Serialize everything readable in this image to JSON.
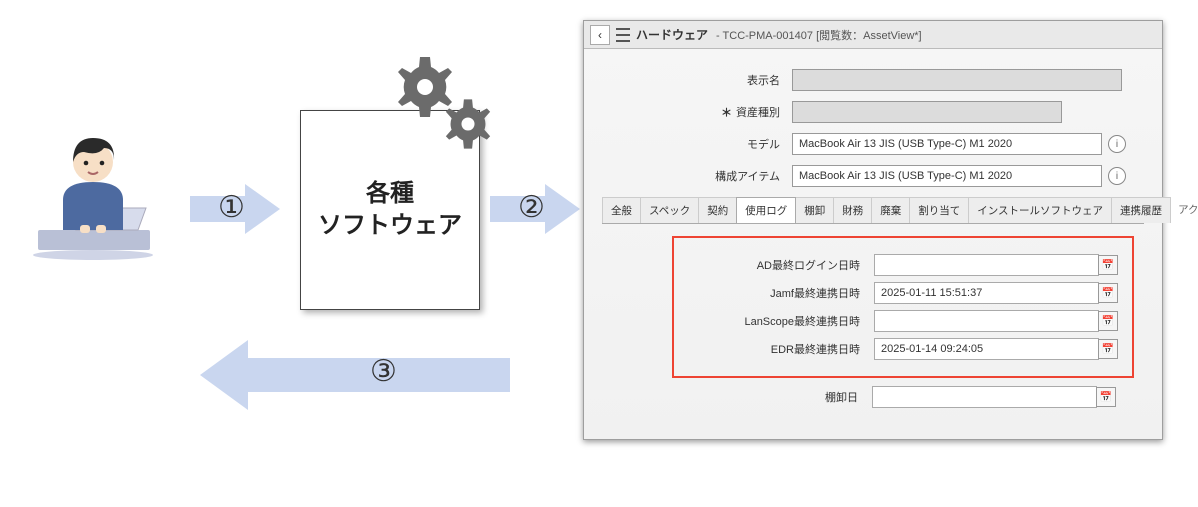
{
  "diagram": {
    "center_box_line1": "各種",
    "center_box_line2": "ソフトウェア",
    "num1": "①",
    "num2": "②",
    "num3": "③"
  },
  "panel": {
    "header": {
      "title": "ハードウェア",
      "subtitle": "- TCC-PMA-001407 [閲覧数：AssetView*]"
    },
    "form": {
      "display_name_label": "表示名",
      "display_name_value": "",
      "asset_type_label": "資産種別",
      "asset_type_required_mark": "＊",
      "asset_type_value": "",
      "model_label": "モデル",
      "model_value": "MacBook Air 13 JIS (USB Type-C) M1 2020",
      "config_item_label": "構成アイテム",
      "config_item_value": "MacBook Air 13 JIS (USB Type-C) M1 2020"
    },
    "tabs": [
      "全般",
      "スペック",
      "契約",
      "使用ログ",
      "棚卸",
      "財務",
      "廃棄",
      "割り当て",
      "インストールソフトウェア",
      "連携履歴",
      "アクティビティ"
    ],
    "active_tab_index": 3,
    "log": {
      "rows": [
        {
          "label": "AD最終ログイン日時",
          "value": ""
        },
        {
          "label": "Jamf最終連携日時",
          "value": "2025-01-11 15:51:37"
        },
        {
          "label": "LanScope最終連携日時",
          "value": ""
        },
        {
          "label": "EDR最終連携日時",
          "value": "2025-01-14 09:24:05"
        }
      ],
      "inventory_date_label": "棚卸日",
      "inventory_date_value": ""
    }
  }
}
